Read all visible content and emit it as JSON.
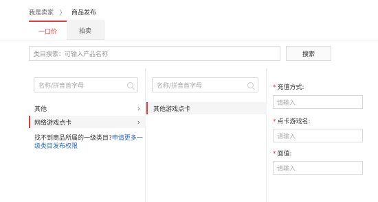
{
  "breadcrumb": {
    "parent": "我是卖家",
    "separator": "〉",
    "current": "商品发布"
  },
  "tabs": [
    {
      "label": "一口价"
    },
    {
      "label": "拍卖"
    }
  ],
  "search": {
    "placeholder": "类目搜索：可输入产品名称",
    "button": "搜索"
  },
  "column1": {
    "placeholder": "名称/拼音首字母",
    "items": [
      {
        "label": "其他"
      },
      {
        "label": "网络游戏点卡"
      }
    ],
    "help_text": "找不到商品所属的一级类目?",
    "help_link": "申请更多一级类目发布权限"
  },
  "column2": {
    "placeholder": "名称/拼音首字母",
    "items": [
      {
        "label": "其他游戏点卡"
      }
    ]
  },
  "form": {
    "fields": [
      {
        "label": "充值方式:",
        "placeholder": "请输入"
      },
      {
        "label": "点卡游戏名:",
        "placeholder": "请输入"
      },
      {
        "label": "面值:",
        "placeholder": "请输入"
      }
    ]
  },
  "colors": {
    "accent": "#e4393c",
    "link": "#2b6cd4"
  }
}
